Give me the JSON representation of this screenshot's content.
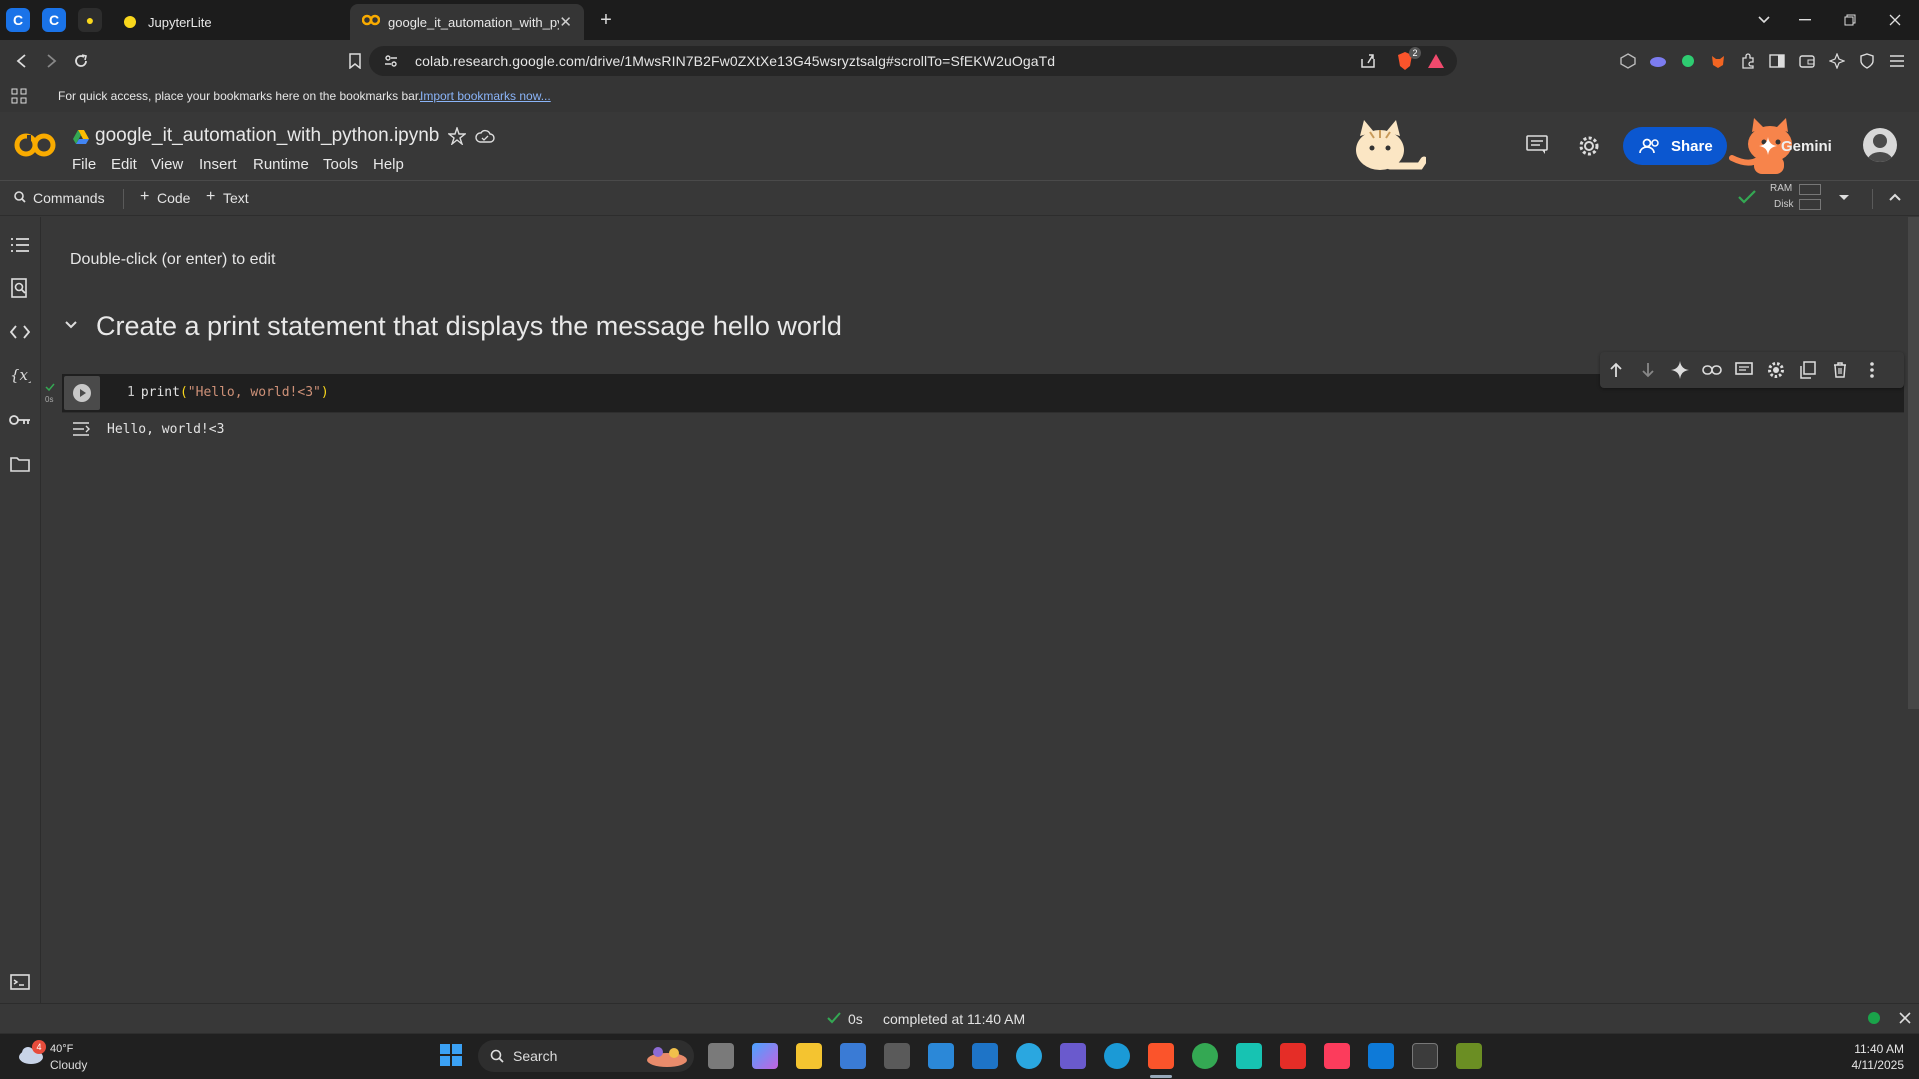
{
  "browser": {
    "tabs": [
      {
        "title": "JupyterLite",
        "active": false
      },
      {
        "title": "google_it_automation_with_pyt",
        "active": true
      }
    ],
    "new_tab_symbol": "+",
    "url": "colab.research.google.com/drive/1MwsRIN7B2Fw0ZXtXe13G45wsryztsalg#scrollTo=SfEKW2uOgaTd",
    "brave_badge": "2",
    "bookmarks_message": "For quick access, place your bookmarks here on the bookmarks bar.",
    "bookmarks_link": "Import bookmarks now..."
  },
  "colab": {
    "logo": "CO",
    "notebook_title": "google_it_automation_with_python.ipynb",
    "menu": [
      "File",
      "Edit",
      "View",
      "Insert",
      "Runtime",
      "Tools",
      "Help"
    ],
    "share_label": "Share",
    "gemini_label": "Gemini",
    "toolbar": {
      "commands_label": "Commands",
      "code_label": "Code",
      "text_label": "Text",
      "ram_label": "RAM",
      "disk_label": "Disk"
    },
    "cells": {
      "text_cell": "Double-click (or enter) to edit",
      "heading": "Create a print statement that displays the message hello world",
      "code_line_number": "1",
      "code_func": "print",
      "code_open": "(",
      "code_string": "\"Hello, world!<3\"",
      "code_close": ")",
      "exec_time": "0s",
      "output": "Hello, world!<3"
    },
    "status": {
      "time": "0s",
      "message": "completed at 11:40 AM"
    }
  },
  "taskbar": {
    "weather_temp": "40°F",
    "weather_cond": "Cloudy",
    "weather_badge": "4",
    "search_label": "Search",
    "clock_time": "11:40 AM",
    "clock_date": "4/11/2025"
  },
  "colors": {
    "accent_blue": "#0b57d0",
    "colab_orange": "#f9ab00",
    "success_green": "#34a853",
    "string_color": "#ce9178",
    "code_text": "#e3e3e3"
  }
}
